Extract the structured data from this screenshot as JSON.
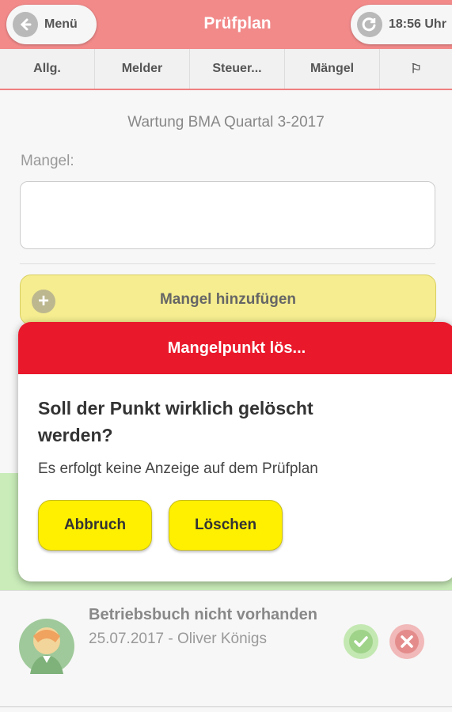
{
  "header": {
    "menu_label": "Menü",
    "title": "Prüfplan",
    "time_label": "18:56 Uhr",
    "color": "#f28a8a"
  },
  "tabs": [
    {
      "label": "Allg."
    },
    {
      "label": "Melder"
    },
    {
      "label": "Steuer..."
    },
    {
      "label": "Mängel"
    },
    {
      "label": "⚐"
    }
  ],
  "main": {
    "subtitle": "Wartung BMA Quartal 3-2017",
    "field_label": "Mangel:",
    "field_value": "",
    "add_button_label": "Mangel hinzufügen"
  },
  "list": {
    "items": [
      {
        "title": "Betriebsbuch nicht vorhanden",
        "subtitle": "25.07.2017 - Oliver Königs"
      }
    ]
  },
  "dialog": {
    "title": "Mangelpunkt lös...",
    "question": "Soll der Punkt wirklich gelöscht werden?",
    "text": "Es erfolgt keine Anzeige auf dem Prüfplan",
    "cancel_label": "Abbruch",
    "delete_label": "Löschen",
    "header_color": "#e9192b",
    "button_color": "#fff000"
  }
}
